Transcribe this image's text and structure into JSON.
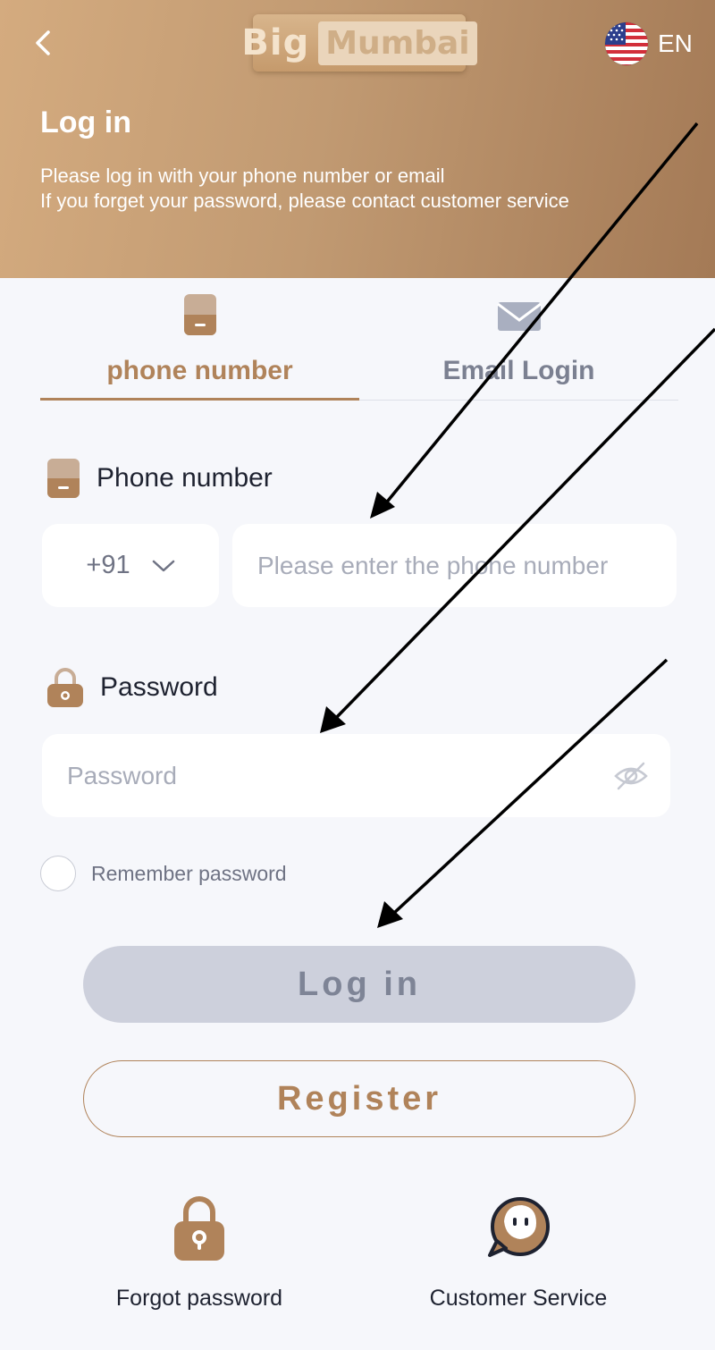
{
  "header": {
    "logo_word1": "Big",
    "logo_word2": "Mumbai",
    "language": "EN",
    "title": "Log in",
    "subtitle_line1": "Please log in with your phone number or email",
    "subtitle_line2": "If you forget your password, please contact customer service"
  },
  "tabs": [
    {
      "label": "phone number",
      "active": true
    },
    {
      "label": "Email Login",
      "active": false
    }
  ],
  "phone_field": {
    "label": "Phone number",
    "country_code": "+91",
    "placeholder": "Please enter the phone number",
    "value": ""
  },
  "password_field": {
    "label": "Password",
    "placeholder": "Password",
    "value": ""
  },
  "remember": {
    "label": "Remember password",
    "checked": false
  },
  "buttons": {
    "login": "Log in",
    "register": "Register"
  },
  "footer": {
    "forgot": "Forgot password",
    "service": "Customer Service"
  },
  "colors": {
    "accent": "#b0835a",
    "header_start": "#d4ab7f",
    "header_end": "#a47a56",
    "background": "#f6f7fb",
    "disabled_button": "#cdd0dc"
  },
  "icons": {
    "back": "chevron-left-icon",
    "language_flag": "us-flag-icon",
    "phone_tab": "phone-icon",
    "email_tab": "envelope-icon",
    "country_dropdown": "chevron-down-icon",
    "password_label": "lock-icon",
    "password_visibility": "eye-off-icon",
    "forgot": "lock-icon",
    "service": "chat-bubble-icon"
  }
}
